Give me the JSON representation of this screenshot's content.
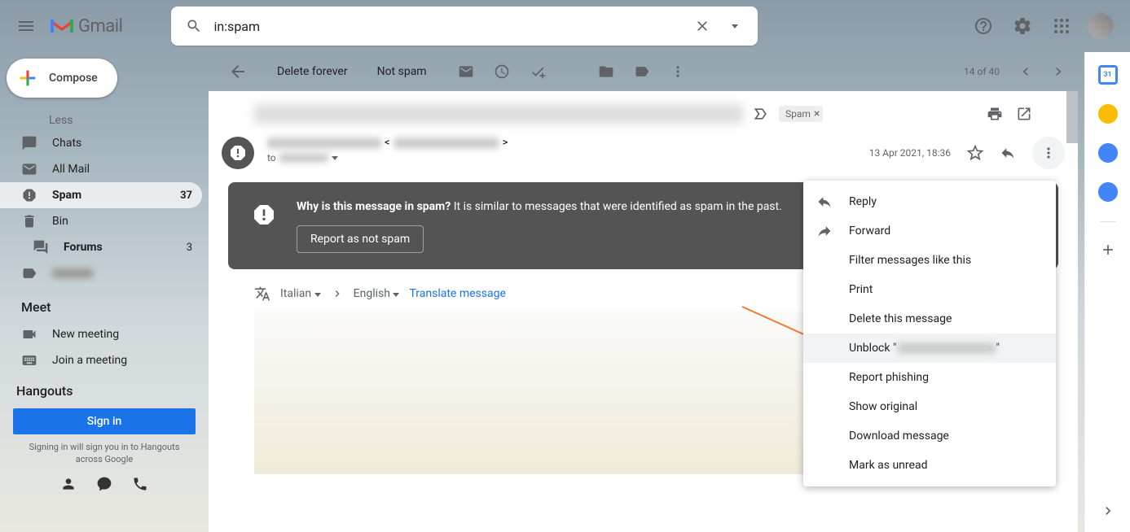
{
  "app": {
    "name": "Gmail"
  },
  "search": {
    "value": "in:spam"
  },
  "compose": {
    "label": "Compose"
  },
  "sidebar": {
    "items": [
      {
        "label": "Less"
      },
      {
        "label": "Chats"
      },
      {
        "label": "All Mail"
      },
      {
        "label": "Spam",
        "count": "37"
      },
      {
        "label": "Bin"
      },
      {
        "label": "Forums",
        "count": "3"
      }
    ]
  },
  "meet": {
    "header": "Meet",
    "new": "New meeting",
    "join": "Join a meeting"
  },
  "hangouts": {
    "header": "Hangouts",
    "signin": "Sign in",
    "note": "Signing in will sign you in to Hangouts across Google"
  },
  "toolbar": {
    "delete_forever": "Delete forever",
    "not_spam": "Not spam",
    "count": "14 of 40"
  },
  "message": {
    "label": "Spam",
    "timestamp": "13 Apr 2021, 18:36",
    "to_prefix": "to",
    "sender_bracket_open": "<",
    "sender_bracket_close": ">"
  },
  "banner": {
    "title": "Why is this message in spam?",
    "text": " It is similar to messages that were identified as spam in the past.",
    "button": "Report as not spam"
  },
  "translate": {
    "from": "Italian",
    "to": "English",
    "link": "Translate message"
  },
  "menu": {
    "reply": "Reply",
    "forward": "Forward",
    "filter": "Filter messages like this",
    "print": "Print",
    "delete": "Delete this message",
    "unblock_prefix": "Unblock \"",
    "unblock_suffix": "\"",
    "phishing": "Report phishing",
    "original": "Show original",
    "download": "Download message",
    "unread": "Mark as unread"
  }
}
